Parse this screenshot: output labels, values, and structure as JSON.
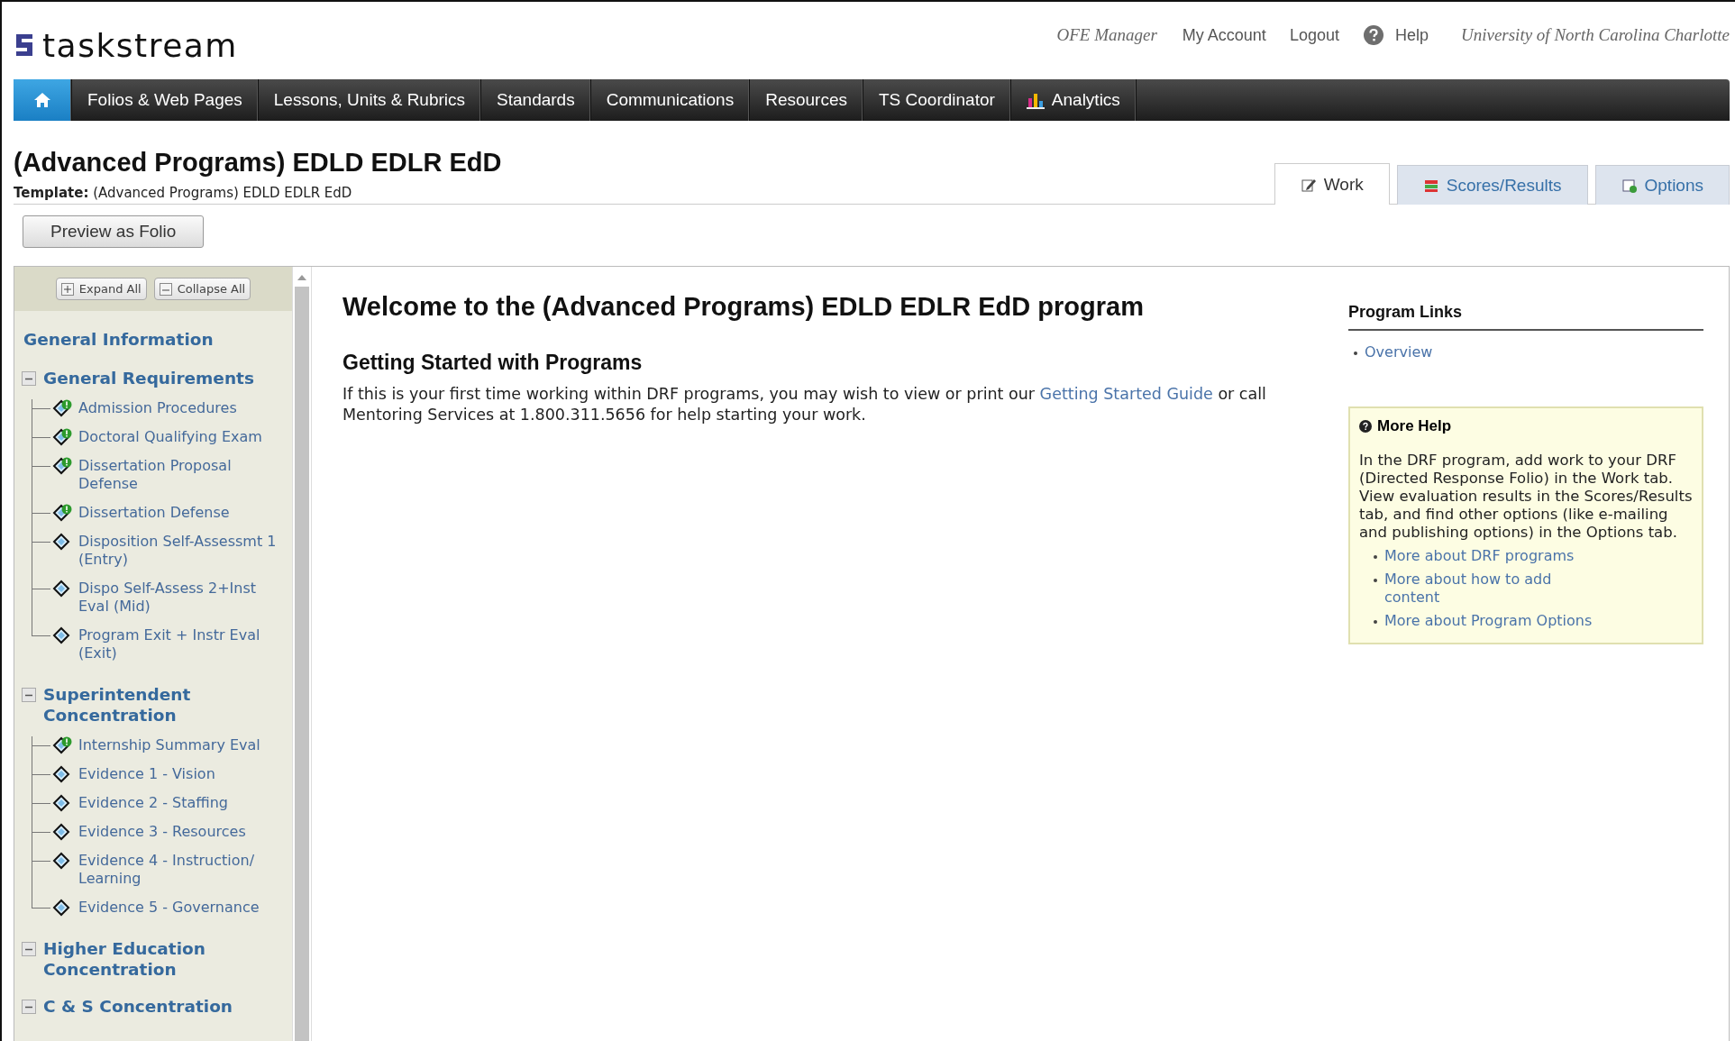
{
  "header": {
    "logo": "taskstream",
    "links": [
      {
        "kind": "role",
        "label": "OFE Manager"
      },
      {
        "kind": "link",
        "label": "My Account"
      },
      {
        "kind": "link",
        "label": "Logout"
      },
      {
        "kind": "help",
        "label": "Help"
      },
      {
        "kind": "org",
        "label": "University of North Carolina Charlotte"
      }
    ]
  },
  "nav": [
    {
      "kind": "home",
      "selected": true
    },
    {
      "kind": "text",
      "label": "Folios & Web Pages",
      "selected": false
    },
    {
      "kind": "text",
      "label": "Lessons, Units & Rubrics",
      "selected": false
    },
    {
      "kind": "text",
      "label": "Standards",
      "selected": false
    },
    {
      "kind": "text",
      "label": "Communications",
      "selected": false
    },
    {
      "kind": "text",
      "label": "Resources",
      "selected": false
    },
    {
      "kind": "text",
      "label": "TS Coordinator",
      "selected": false
    },
    {
      "kind": "analytics",
      "label": "Analytics",
      "selected": false
    }
  ],
  "page": {
    "title": "(Advanced Programs) EDLD EDLR EdD",
    "template": "**Template:** (Advanced Programs) EDLD EDLR EdD",
    "preview_button": "Preview as Folio"
  },
  "tabs": [
    {
      "kind": "work",
      "label": "Work",
      "selected": true
    },
    {
      "kind": "scores",
      "label": "Scores/Results",
      "selected": false
    },
    {
      "kind": "options",
      "label": "Options",
      "selected": false
    }
  ],
  "sidebar": {
    "buttons": [
      {
        "kind": "expand",
        "label": "Expand All"
      },
      {
        "kind": "collapse",
        "label": "Collapse All"
      }
    ],
    "sections": [
      {
        "kind": "heading",
        "title": "General Information"
      },
      {
        "kind": "group",
        "title": "General Requirements",
        "expanded": true,
        "children": [
          {
            "label": "Admission Procedures",
            "kind": "alert"
          },
          {
            "label": "Doctoral Qualifying Exam",
            "kind": "alert"
          },
          {
            "label": "Dissertation Proposal Defense",
            "kind": "alert"
          },
          {
            "label": "Dissertation Defense",
            "kind": "alert"
          },
          {
            "label": "Disposition Self-Assessmt 1 (Entry)",
            "kind": "plain"
          },
          {
            "label": "Dispo Self-Assess 2+Inst Eval (Mid)",
            "kind": "plain"
          },
          {
            "label": "Program Exit + Instr Eval (Exit)",
            "kind": "plain"
          }
        ]
      },
      {
        "kind": "group",
        "title": "Superintendent Concentration",
        "expanded": true,
        "children": [
          {
            "label": "Internship Summary Eval",
            "kind": "alert"
          },
          {
            "label": "Evidence 1 - Vision",
            "kind": "plain"
          },
          {
            "label": "Evidence 2 - Staffing",
            "kind": "plain"
          },
          {
            "label": "Evidence 3 - Resources",
            "kind": "plain"
          },
          {
            "label": "Evidence 4 - Instruction/ Learning",
            "kind": "plain"
          },
          {
            "label": "Evidence 5 - Governance",
            "kind": "plain"
          }
        ]
      },
      {
        "kind": "group",
        "title": "Higher Education Concentration",
        "expanded": true
      },
      {
        "kind": "group",
        "title": "C & S Concentration",
        "expanded": true
      }
    ]
  },
  "main": {
    "title": "Welcome to the (Advanced Programs) EDLD EDLR EdD program",
    "subtitle": "Getting Started with Programs",
    "body": [
      {
        "kind": "text",
        "text": "If this is your first time working within DRF programs, you may wish to view or print our "
      },
      {
        "kind": "link",
        "text": "Getting Started Guide"
      },
      {
        "kind": "text",
        "text": " or call Mentoring Services at 1.800.311.5656 for help starting your work."
      }
    ]
  },
  "program_links": {
    "title": "Program Links",
    "links": [
      "Overview"
    ]
  },
  "more_help": {
    "title": "More Help",
    "text": "In the DRF program, add work to your DRF (Directed Response Folio) in the Work tab. View evaluation results in the Scores/Results tab, and find other options (like e-mailing and publishing options) in the Options tab.",
    "links": [
      "More about DRF programs",
      "More about how to add content",
      "More about Program Options"
    ]
  }
}
